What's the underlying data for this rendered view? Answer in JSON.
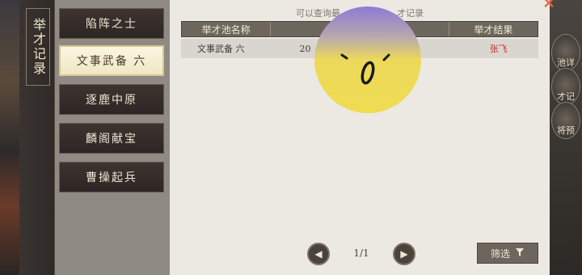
{
  "title_column": {
    "title": "举才记录"
  },
  "tabs": [
    {
      "label": "陷阵之士",
      "active": false
    },
    {
      "label": "文事武备 六",
      "active": true
    },
    {
      "label": "逐鹿中原",
      "active": false
    },
    {
      "label": "麟阁献宝",
      "active": false
    },
    {
      "label": "曹操起兵",
      "active": false
    }
  ],
  "panel": {
    "hint": "可以查询最",
    "hint_tail": "才记录",
    "columns": [
      "举才池名称",
      "",
      "",
      "举才结果"
    ],
    "rows": [
      {
        "pool": "文事武备 六",
        "time": "20",
        "extra": "",
        "result": "张飞"
      }
    ]
  },
  "pagination": {
    "current": "1/1"
  },
  "filter": {
    "label": "筛选"
  },
  "right_side": {
    "items": [
      "池详",
      "才记",
      "将预"
    ]
  },
  "colors": {
    "result_red": "#c23030",
    "active_tab_border": "#d9c690"
  }
}
